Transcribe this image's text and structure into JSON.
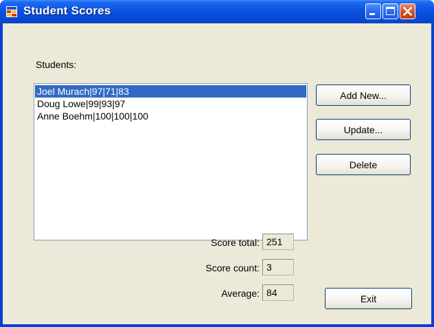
{
  "window": {
    "title": "Student Scores"
  },
  "students_label": "Students:",
  "students": [
    {
      "text": "Joel Murach|97|71|83",
      "selected": true
    },
    {
      "text": "Doug Lowe|99|93|97",
      "selected": false
    },
    {
      "text": "Anne Boehm|100|100|100",
      "selected": false
    }
  ],
  "buttons": {
    "add_new": "Add New...",
    "update": "Update...",
    "delete": "Delete",
    "exit": "Exit"
  },
  "stats": {
    "score_total_label": "Score total:",
    "score_total_value": "251",
    "score_count_label": "Score count:",
    "score_count_value": "3",
    "average_label": "Average:",
    "average_value": "84"
  },
  "colors": {
    "selection": "#316ac5",
    "titlebar": "#0a55e0",
    "client_bg": "#ece9d8"
  }
}
